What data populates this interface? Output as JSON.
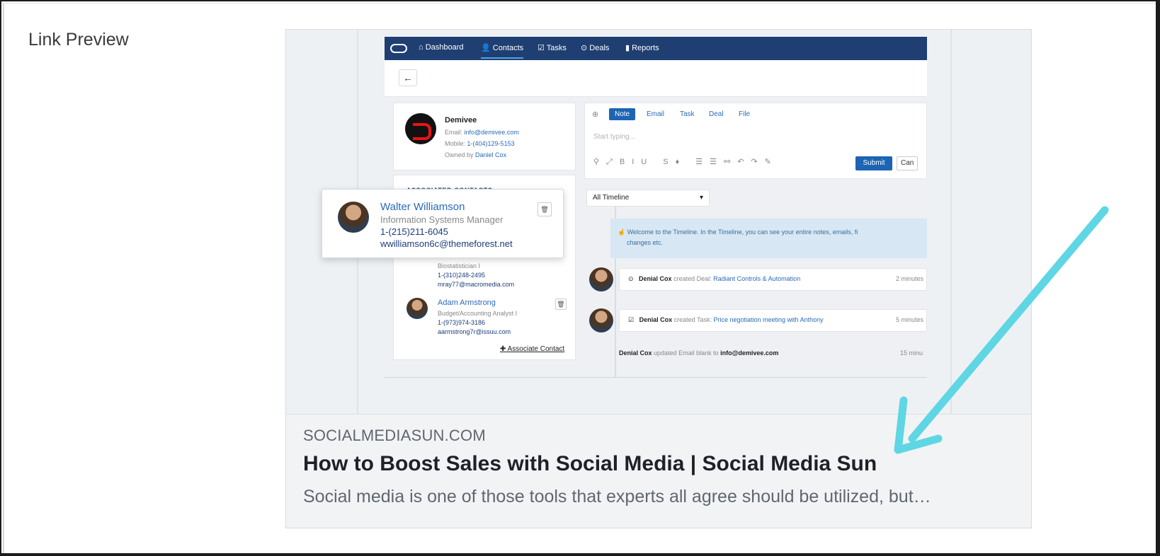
{
  "field_label": "Link Preview",
  "preview": {
    "domain": "SOCIALMEDIASUN.COM",
    "title": "How to Boost Sales with Social Media | Social Media Sun",
    "description": "Social media is one of those tools that experts all agree should be utilized, but…"
  },
  "image": {
    "nav": [
      "Dashboard",
      "Contacts",
      "Tasks",
      "Deals",
      "Reports"
    ],
    "company": {
      "name": "Demivee",
      "email_label": "Email:",
      "email": "info@demivee.com",
      "mobile_label": "Mobile:",
      "mobile": "1-(404)129-5153",
      "owner_label": "Owned by",
      "owner": "Daniel Cox"
    },
    "associated_heading": "ASSOCIATED CONTACTS",
    "contact_hidden": {
      "role": "Biostatistician I",
      "phone": "1-(310)248-2495",
      "email": "mray77@macromedia.com"
    },
    "contact_adam": {
      "name": "Adam Armstrong",
      "role": "Budget/Accounting Analyst I",
      "phone": "1-(973)974-3186",
      "email": "aarmstrong7r@issuu.com"
    },
    "associate_link": "Associate Contact",
    "popup": {
      "name": "Walter Williamson",
      "role": "Information Systems Manager",
      "phone": "1-(215)211-6045",
      "email": "wwilliamson6c@themeforest.net"
    },
    "tabs": [
      "Note",
      "Email",
      "Task",
      "Deal",
      "File"
    ],
    "placeholder": "Start typing...",
    "submit": "Submit",
    "cancel": "Can",
    "timeline_select": "All Timeline",
    "info_line1": "Welcome to the Timeline. In the Timeline, you can see your entire notes, emails, fi",
    "info_line2": "changes etc.",
    "entry1": {
      "actor": "Denial Cox",
      "action": "created Deal:",
      "link": "Radiant Controls & Automation",
      "time": "2 minutes"
    },
    "entry2": {
      "actor": "Denial Cox",
      "action": "created Task:",
      "link": "Price negotiation meeting with Anthony",
      "time": "5 minutes"
    },
    "entry3": {
      "actor": "Denial Cox",
      "action": "updated Email blank to",
      "target": "info@demivee.com",
      "time": "15 minu"
    }
  },
  "colors": {
    "arrow": "#5fd6e3",
    "title": "#1d2129",
    "meta_text": "#606770",
    "nav": "#1f3f73"
  }
}
